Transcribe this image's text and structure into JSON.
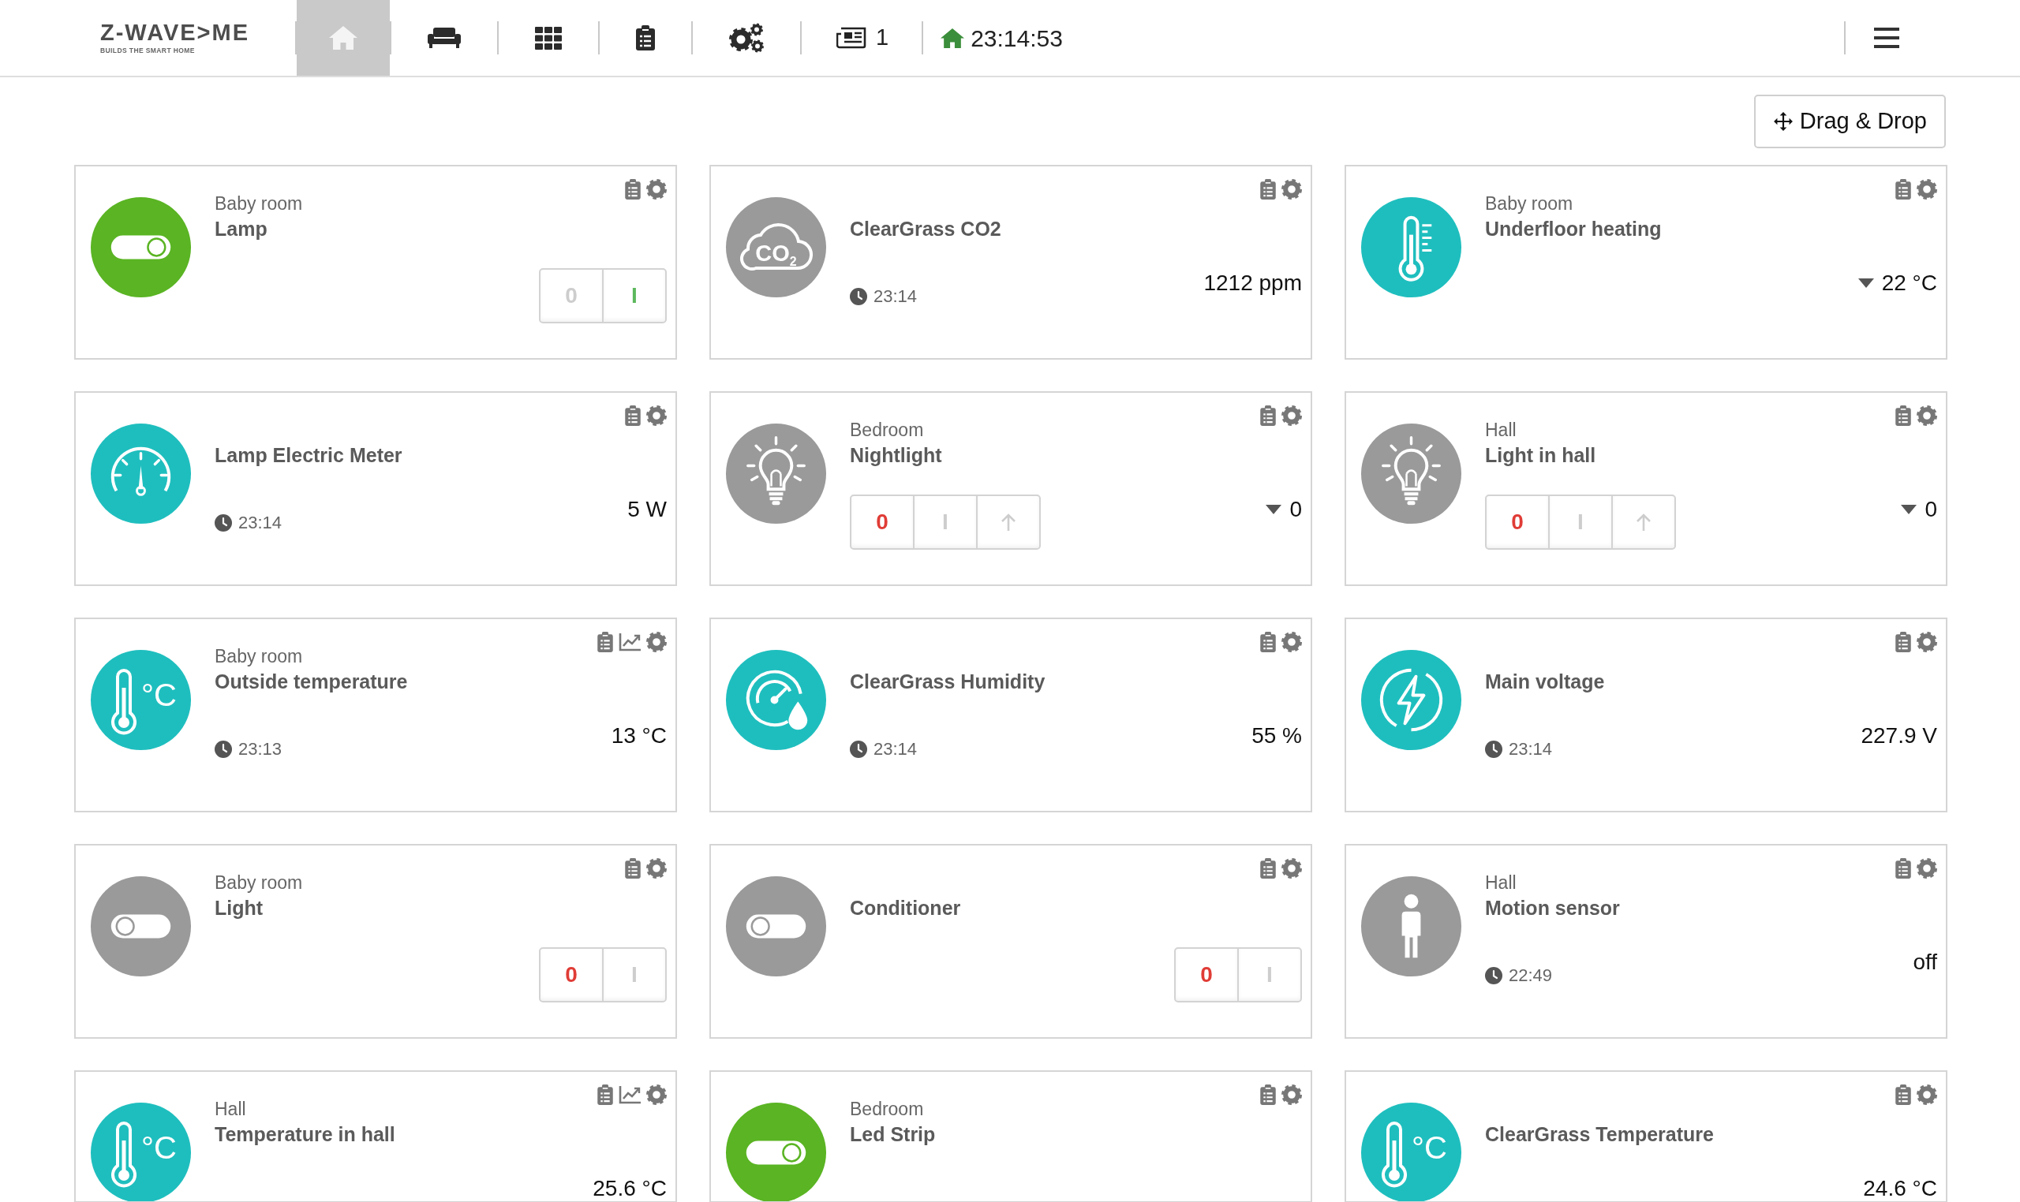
{
  "navbar": {
    "logo": {
      "wordmark": "Z-WAVE>ME",
      "tagline": "BUILDS THE SMART HOME"
    },
    "tabs": [
      {
        "kind": "home",
        "selected": true
      },
      {
        "kind": "rooms",
        "selected": false
      },
      {
        "kind": "elements",
        "selected": false
      },
      {
        "kind": "events",
        "selected": false
      },
      {
        "kind": "configuration",
        "selected": false
      }
    ],
    "notifications": {
      "count": "1"
    },
    "connection": {
      "time": "23:14:53"
    }
  },
  "toolbar": {
    "drag_drop_button": "Drag & Drop"
  },
  "widgets": [
    {
      "kind": "switch",
      "location": "Baby room",
      "name": "Lamp",
      "color": "#5ab423",
      "on": true,
      "buttons": [
        "0",
        "I"
      ]
    },
    {
      "kind": "co2",
      "name": "ClearGrass CO2",
      "icon_label": "CO$_{2}$",
      "color": "#9a9a9a",
      "time": "23:14",
      "value": "1212 ppm"
    },
    {
      "kind": "thermostat",
      "location": "Baby room",
      "name": "Underfloor heating",
      "color": "#1fbebe",
      "value": "22 °C"
    },
    {
      "kind": "power",
      "name": "Lamp Electric Meter",
      "color": "#1fbebe",
      "time": "23:14",
      "value": "5 W"
    },
    {
      "kind": "dimmer",
      "location": "Bedroom",
      "name": "Nightlight",
      "color": "#9a9a9a",
      "on": false,
      "buttons": [
        "0",
        "I"
      ],
      "value": "0"
    },
    {
      "kind": "dimmer",
      "location": "Hall",
      "name": "Light in hall",
      "color": "#9a9a9a",
      "on": false,
      "buttons": [
        "0",
        "I"
      ],
      "value": "0"
    },
    {
      "kind": "temperature",
      "location": "Baby room",
      "name": "Outside temperature",
      "icon_label": "°C",
      "color": "#1fbebe",
      "history": true,
      "time": "23:13",
      "value": "13 °C"
    },
    {
      "kind": "humidity",
      "name": "ClearGrass Humidity",
      "color": "#1fbebe",
      "time": "23:14",
      "value": "55 %"
    },
    {
      "kind": "voltage",
      "name": "Main voltage",
      "color": "#1fbebe",
      "time": "23:14",
      "value": "227.9 V"
    },
    {
      "kind": "switch",
      "location": "Baby room",
      "name": "Light",
      "color": "#9a9a9a",
      "on": false,
      "buttons": [
        "0",
        "I"
      ]
    },
    {
      "kind": "switch",
      "name": "Conditioner",
      "color": "#9a9a9a",
      "on": false,
      "buttons": [
        "0",
        "I"
      ]
    },
    {
      "kind": "motion",
      "location": "Hall",
      "name": "Motion sensor",
      "color": "#9a9a9a",
      "time": "22:49",
      "value": "off"
    },
    {
      "kind": "temperature",
      "location": "Hall",
      "name": "Temperature in hall",
      "icon_label": "°C",
      "color": "#1fbebe",
      "history": true,
      "value": "25.6 °C"
    },
    {
      "kind": "switch",
      "location": "Bedroom",
      "name": "Led Strip",
      "color": "#5ab423",
      "on": true
    },
    {
      "kind": "temperature",
      "name": "ClearGrass Temperature",
      "icon_label": "°C",
      "color": "#1fbebe",
      "value": "24.6 °C"
    }
  ]
}
